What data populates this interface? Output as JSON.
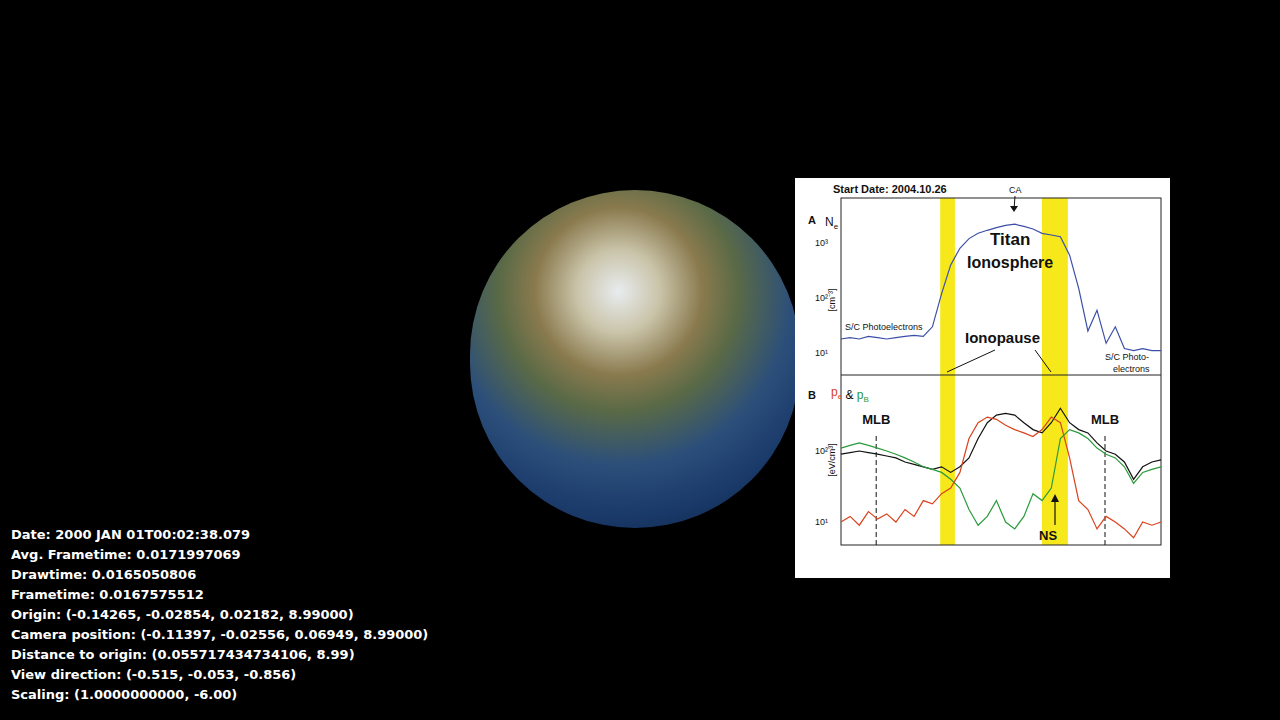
{
  "scene": {
    "overlay": [
      "Date: 2000 JAN 01T00:02:38.079",
      "Avg. Frametime: 0.0171997069",
      "Drawtime: 0.0165050806",
      "Frametime: 0.0167575512",
      "Origin: (-0.14265, -0.02854, 0.02182, 8.99000)",
      "Camera position: (-0.11397, -0.02556, 0.06949, 8.99000)",
      "Distance to origin: (0.055717434734106, 8.99)",
      "View direction: (-0.515, -0.053, -0.856)",
      "Scaling: (1.0000000000, -6.00)"
    ]
  },
  "chart": {
    "start_date": "Start Date: 2004.10.26",
    "highlight_bands": [
      {
        "from": 0.31,
        "to": 0.356
      },
      {
        "from": 0.628,
        "to": 0.709
      }
    ],
    "panel_a": {
      "label": "A",
      "quantity": {
        "symbol": "N",
        "subscript": "e"
      },
      "unit": "[cm⁻³]",
      "ticks": [
        {
          "label": "10³",
          "value": 1000
        },
        {
          "label": "10²",
          "value": 100
        },
        {
          "label": "10¹",
          "value": 10
        }
      ],
      "annotations": {
        "ca": "CA",
        "titan": "Titan",
        "ionosphere": "Ionosphere",
        "left_photo": "S/C Photoelectrons",
        "ionopause": "Ionopause",
        "right_photo_1": "S/C Photo-",
        "right_photo_2": "electrons"
      },
      "series": [
        {
          "name": "Ne",
          "color": "#3b4fa8",
          "values": [
            18,
            19,
            18,
            20,
            19,
            18,
            19,
            20,
            21,
            20,
            30,
            120,
            400,
            800,
            1200,
            1500,
            1700,
            1900,
            2100,
            2200,
            2000,
            1800,
            1500,
            1400,
            1300,
            600,
            150,
            25,
            60,
            15,
            30,
            12,
            11,
            12,
            11,
            11
          ]
        }
      ]
    },
    "panel_b": {
      "label": "B",
      "quantity": [
        {
          "symbol": "p",
          "subscript": "e",
          "color": "#d9421c"
        },
        {
          "symbol": " & ",
          "subscript": "",
          "color": "#000000"
        },
        {
          "symbol": "p",
          "subscript": "B",
          "color": "#2a9a3a"
        }
      ],
      "unit": "[eV/cm³]",
      "ticks": [
        {
          "label": "10²",
          "value": 100
        },
        {
          "label": "10¹",
          "value": 10
        }
      ],
      "boundaries": [
        {
          "label": "MLB",
          "at": 0.11
        },
        {
          "label": "MLB",
          "at": 0.825
        }
      ],
      "ns": "NS",
      "series": [
        {
          "name": "total",
          "color": "#111111",
          "values": [
            90,
            95,
            100,
            95,
            90,
            85,
            80,
            70,
            65,
            60,
            55,
            60,
            50,
            60,
            80,
            150,
            250,
            320,
            340,
            320,
            250,
            200,
            180,
            250,
            400,
            250,
            200,
            180,
            130,
            100,
            90,
            70,
            40,
            60,
            70,
            75
          ]
        },
        {
          "name": "pB",
          "color": "#2a9a3a",
          "values": [
            110,
            120,
            130,
            120,
            110,
            100,
            90,
            80,
            70,
            60,
            55,
            50,
            40,
            30,
            15,
            9,
            12,
            20,
            10,
            8,
            12,
            25,
            20,
            30,
            150,
            200,
            180,
            150,
            110,
            90,
            80,
            60,
            35,
            50,
            55,
            60
          ]
        },
        {
          "name": "pe",
          "color": "#d9421c",
          "values": [
            10,
            12,
            9,
            14,
            11,
            13,
            10,
            15,
            12,
            20,
            18,
            25,
            30,
            50,
            150,
            250,
            300,
            280,
            230,
            200,
            180,
            160,
            200,
            300,
            250,
            80,
            20,
            15,
            8,
            12,
            10,
            8,
            6,
            10,
            9,
            10
          ]
        }
      ]
    }
  }
}
